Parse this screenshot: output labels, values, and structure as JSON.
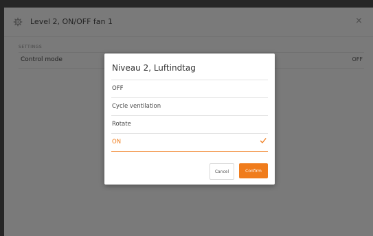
{
  "panel": {
    "title": "Level 2, ON/OFF fan 1",
    "close_symbol": "×",
    "section_label": "SETTINGS",
    "setting": {
      "name": "Control mode",
      "value": "OFF"
    }
  },
  "dialog": {
    "title": "Niveau 2, Luftindtag",
    "options": [
      {
        "label": "OFF",
        "selected": false
      },
      {
        "label": "Cycle ventilation",
        "selected": false
      },
      {
        "label": "Rotate",
        "selected": false
      },
      {
        "label": "ON",
        "selected": true
      }
    ],
    "cancel_label": "Cancel",
    "confirm_label": "Confirm"
  },
  "colors": {
    "accent": "#f07c1c",
    "frame": "#262626",
    "panel_bg": "#f5f5f5",
    "overlay": "rgba(0,0,0,0.5)"
  },
  "icons": {
    "header": "gear-icon",
    "close": "close-icon",
    "selected": "checkmark-icon"
  }
}
